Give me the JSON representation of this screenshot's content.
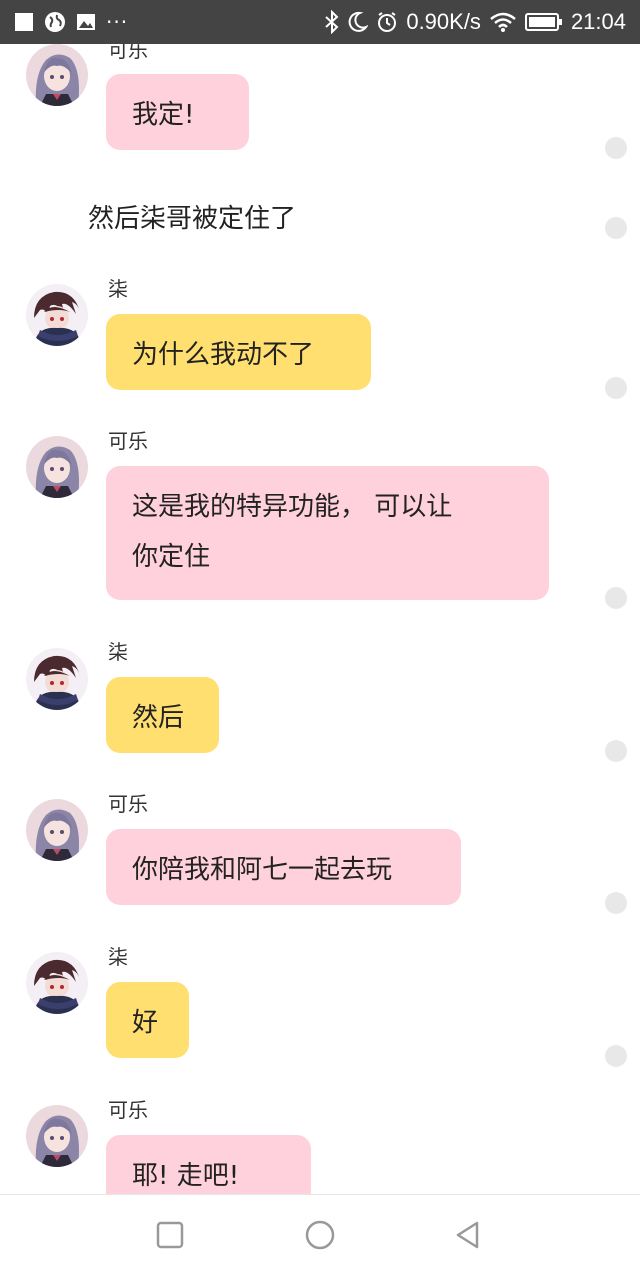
{
  "status_bar": {
    "network_speed": "0.90K/s",
    "time": "21:04",
    "left_icons": [
      "square-icon",
      "globe-icon",
      "image-icon",
      "more-dots-icon"
    ],
    "right_icons": [
      "bluetooth-icon",
      "moon-icon",
      "alarm-icon",
      "wifi-icon",
      "battery-icon"
    ],
    "more_dots": "···"
  },
  "chat": {
    "messages": [
      {
        "type": "message",
        "sender": "可乐",
        "text": "我定!",
        "bubble_color": "#ffd1dc"
      },
      {
        "type": "narration",
        "text": "然后柒哥被定住了"
      },
      {
        "type": "message",
        "sender": "柒",
        "text": "为什么我动不了",
        "bubble_color": "#ffdf6f"
      },
      {
        "type": "message",
        "sender": "可乐",
        "text": "这是我的特异功能， 可以让\n你定住",
        "bubble_color": "#ffd1dc"
      },
      {
        "type": "message",
        "sender": "柒",
        "text": "然后",
        "bubble_color": "#ffdf6f"
      },
      {
        "type": "message",
        "sender": "可乐",
        "text": "你陪我和阿七一起去玩",
        "bubble_color": "#ffd1dc"
      },
      {
        "type": "message",
        "sender": "柒",
        "text": "好",
        "bubble_color": "#ffdf6f"
      },
      {
        "type": "message",
        "sender": "可乐",
        "text": "耶! 走吧!",
        "bubble_color": "#ffd1dc"
      }
    ]
  },
  "nav_bar": {
    "buttons": [
      "recent-apps-icon",
      "home-icon",
      "back-icon"
    ]
  },
  "colors": {
    "status_bar_bg": "#444444",
    "pink_bubble": "#ffd1dc",
    "yellow_bubble": "#ffdf6f",
    "dot": "#e8e8e8"
  }
}
